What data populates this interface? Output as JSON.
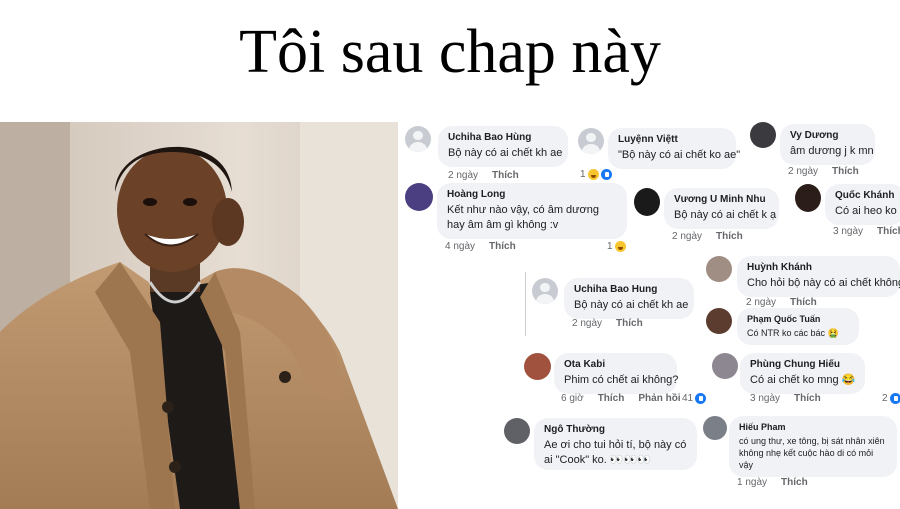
{
  "title": "Tôi sau chap này",
  "comments": [
    {
      "id": "c1",
      "name": "Uchiha Bao Hùng",
      "text": "Bộ này có ai chết kh ae",
      "time": "2 ngày",
      "action": "Thích"
    },
    {
      "id": "c2",
      "name": "Luyệnn Việtt",
      "text": "\"Bộ này có ai chết ko ae\"",
      "reactions": "1"
    },
    {
      "id": "c3",
      "name": "Vy Dương",
      "text": "âm dương j k mn",
      "time": "2 ngày",
      "action": "Thích"
    },
    {
      "id": "c4",
      "name": "Hoàng Long",
      "text": "Kết như nào vậy, có âm dương hay âm âm gì không :v",
      "time": "4 ngày",
      "action": "Thích",
      "reactions": "1"
    },
    {
      "id": "c5",
      "name": "Vương U Minh Nhu",
      "text": "Bộ này có ai chết k ạ",
      "time": "2 ngày",
      "action": "Thích"
    },
    {
      "id": "c6",
      "name": "Quốc Khánh",
      "text": "Có ai heo ko ??",
      "time": "3 ngày",
      "action": "Thích"
    },
    {
      "id": "c7",
      "name": "Huỳnh Khánh",
      "text": "Cho hỏi bộ này có ai chết không?",
      "time": "2 ngày",
      "action": "Thích"
    },
    {
      "id": "c8",
      "name": "Uchiha Bao Hung",
      "text": "Bộ này có ai chết kh ae",
      "time": "2 ngày",
      "action": "Thích"
    },
    {
      "id": "c9",
      "name": "Phạm Quốc Tuấn",
      "text": "Có NTR ko các bác 🤮"
    },
    {
      "id": "c10",
      "name": "Ota Kabi",
      "text": "Phim có chết ai không?",
      "time": "6 giờ",
      "action": "Thích",
      "reply": "Phản hồi",
      "reactions": "41"
    },
    {
      "id": "c11",
      "name": "Phùng Chung Hiếu",
      "text": "Có ai chết ko mng 😂",
      "time": "3 ngày",
      "action": "Thích",
      "reactions": "2"
    },
    {
      "id": "c12",
      "name": "Ngô Thường",
      "text": "Ae ơi cho tui hỏi tí, bộ này có ai \"Cook\" ko. 👀👀👀"
    },
    {
      "id": "c13",
      "name": "Hiếu Pham",
      "text": "có ung thư, xe tông, bị sát nhân xiên không nhẹ kết cuộc hào di có mỏi vậy",
      "time": "1 ngày",
      "action": "Thích"
    }
  ],
  "colors": {
    "bubble": "#f0f2f5",
    "meta": "#65676b",
    "like": "#1877f2",
    "haha": "#f7c52d"
  }
}
